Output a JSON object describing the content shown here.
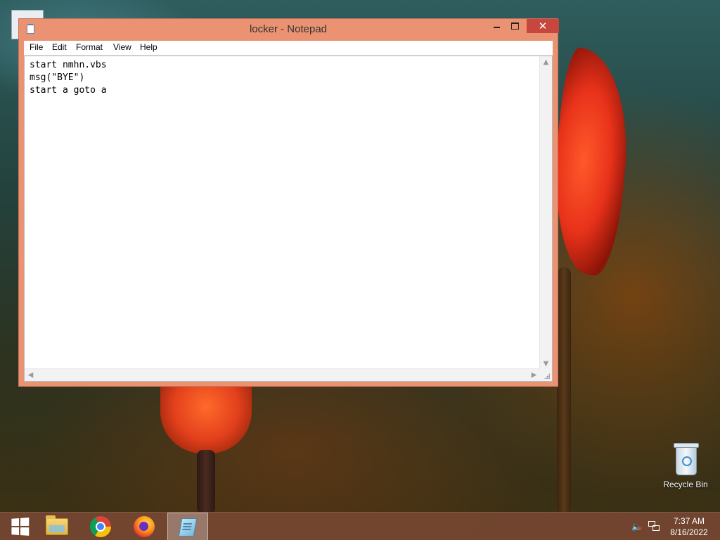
{
  "window": {
    "title": "locker - Notepad",
    "close_glyph": "✕"
  },
  "menu": {
    "items": [
      "File",
      "Edit",
      "Format",
      "View",
      "Help"
    ]
  },
  "editor": {
    "lines": [
      "start nmhn.vbs",
      "msg(\"BYE\")",
      "start a goto a"
    ]
  },
  "desktop": {
    "recycle_bin_label": "Recycle Bin"
  },
  "taskbar": {
    "apps": [
      "file-explorer-icon",
      "chrome-icon",
      "firefox-icon",
      "notepad-icon"
    ],
    "active_app": "notepad-icon"
  },
  "tray": {
    "time": "7:37 AM",
    "date": "8/16/2022",
    "volume_state": "muted"
  },
  "colors": {
    "window_frame": "#ea9272",
    "close_button": "#c7463d",
    "taskbar": "#784832"
  }
}
